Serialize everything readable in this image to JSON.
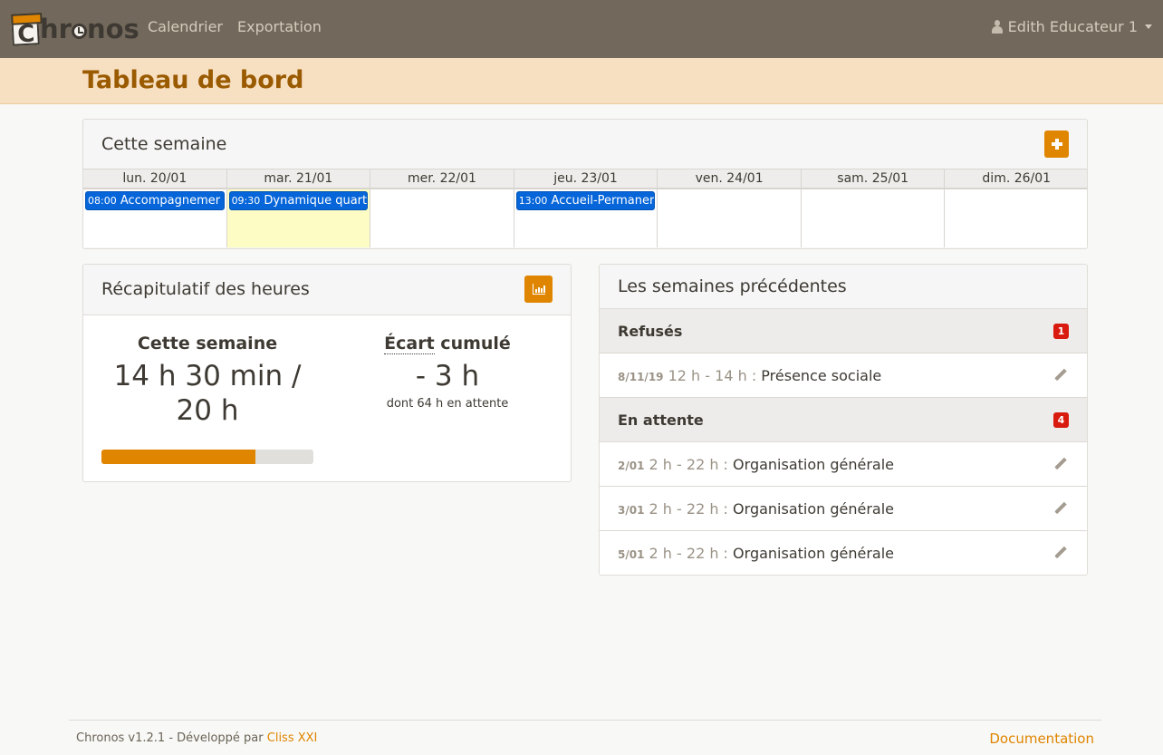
{
  "navbar": {
    "brand": "Chronos",
    "links": [
      "Calendrier",
      "Exportation"
    ],
    "user": "Edith Educateur 1"
  },
  "page": {
    "title": "Tableau de bord"
  },
  "week_card": {
    "title": "Cette semaine",
    "add_icon": "plus-icon",
    "days": [
      {
        "label": "lun. 20/01",
        "today": false,
        "events": [
          {
            "time": "08:00",
            "title": "Accompagnemer"
          }
        ]
      },
      {
        "label": "mar. 21/01",
        "today": true,
        "events": [
          {
            "time": "09:30",
            "title": "Dynamique quart"
          }
        ]
      },
      {
        "label": "mer. 22/01",
        "today": false,
        "events": []
      },
      {
        "label": "jeu. 23/01",
        "today": false,
        "events": [
          {
            "time": "13:00",
            "title": "Accueil-Permaner"
          }
        ]
      },
      {
        "label": "ven. 24/01",
        "today": false,
        "events": []
      },
      {
        "label": "sam. 25/01",
        "today": false,
        "events": []
      },
      {
        "label": "dim. 26/01",
        "today": false,
        "events": []
      }
    ]
  },
  "recap": {
    "title": "Récapitulatif des heures",
    "chart_icon": "bar-chart-icon",
    "week": {
      "heading": "Cette semaine",
      "value_line1": "14 h 30 min /",
      "value_line2": "20 h",
      "progress": 0.725
    },
    "cumul": {
      "heading_abbr": "Écart",
      "heading_rest": " cumulé",
      "value": "- 3 h",
      "note": "dont 64 h en attente"
    }
  },
  "previous": {
    "title": "Les semaines précédentes",
    "groups": [
      {
        "label": "Refusés",
        "count": "1",
        "items": [
          {
            "date": "8/11/19",
            "hours": "12 h - 14 h :",
            "activity": "Présence sociale"
          }
        ]
      },
      {
        "label": "En attente",
        "count": "4",
        "items": [
          {
            "date": "2/01",
            "hours": "2 h - 22 h :",
            "activity": "Organisation générale"
          },
          {
            "date": "3/01",
            "hours": "2 h - 22 h :",
            "activity": "Organisation générale"
          },
          {
            "date": "5/01",
            "hours": "2 h - 22 h :",
            "activity": "Organisation générale"
          }
        ]
      }
    ]
  },
  "footer": {
    "text": "Chronos v1.2.1 - Développé par ",
    "company": "Cliss XXI",
    "doc_link": "Documentation"
  },
  "colors": {
    "accent": "#e08500",
    "navbar": "#72695c",
    "event": "#0565d9",
    "badge": "#d81a0f",
    "today": "#fcfcc4"
  }
}
